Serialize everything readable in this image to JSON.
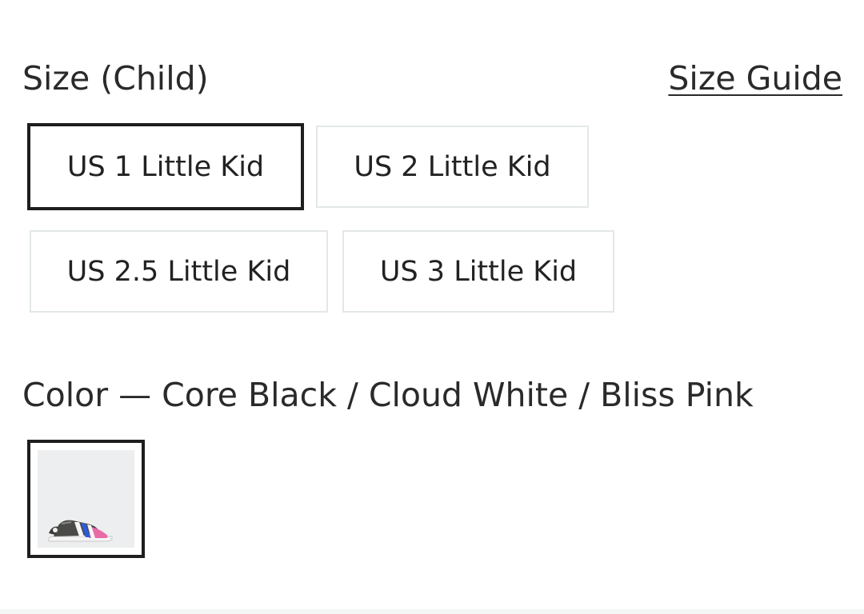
{
  "size_section": {
    "label": "Size (Child)",
    "guide_link": "Size Guide",
    "options": [
      {
        "label": "US 1 Little Kid",
        "selected": true
      },
      {
        "label": "US 2 Little Kid",
        "selected": false
      },
      {
        "label": "US 2.5 Little Kid",
        "selected": false
      },
      {
        "label": "US 3 Little Kid",
        "selected": false
      }
    ]
  },
  "color_section": {
    "label": "Color — Core Black / Cloud White / Bliss Pink",
    "swatch": {
      "icon": "sneaker-thumbnail",
      "selected": true
    }
  },
  "colors": {
    "selected_border": "#1e1e1e",
    "option_border": "#e3e8e8",
    "text": "#222222"
  }
}
